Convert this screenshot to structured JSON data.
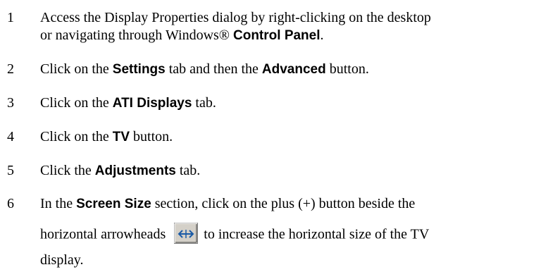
{
  "steps": [
    {
      "number": "1",
      "line1_a": "Access the Display Properties dialog by right-clicking on the desktop",
      "line2_a": "or navigating through Windows® ",
      "line2_bold": "Control Panel",
      "line2_b": "."
    },
    {
      "number": "2",
      "a": "Click on the ",
      "bold1": "Settings",
      "b": " tab and then the ",
      "bold2": "Advanced",
      "c": " button."
    },
    {
      "number": "3",
      "a": "Click on the ",
      "bold1": "ATI Displays",
      "b": " tab."
    },
    {
      "number": "4",
      "a": "Click on the ",
      "bold1": "TV",
      "b": " button."
    },
    {
      "number": "5",
      "a": "Click the ",
      "bold1": "Adjustments",
      "b": " tab."
    },
    {
      "number": "6",
      "line1_a": "In the ",
      "line1_bold": "Screen Size",
      "line1_b": " section",
      "line1_c": ", click on the plus (+) button beside the",
      "line2_a": "horizontal arrowheads",
      "line2_b": "to increase the horizontal size of the TV",
      "line3": "display.",
      "icon": "horizontal-arrowheads-icon"
    }
  ]
}
